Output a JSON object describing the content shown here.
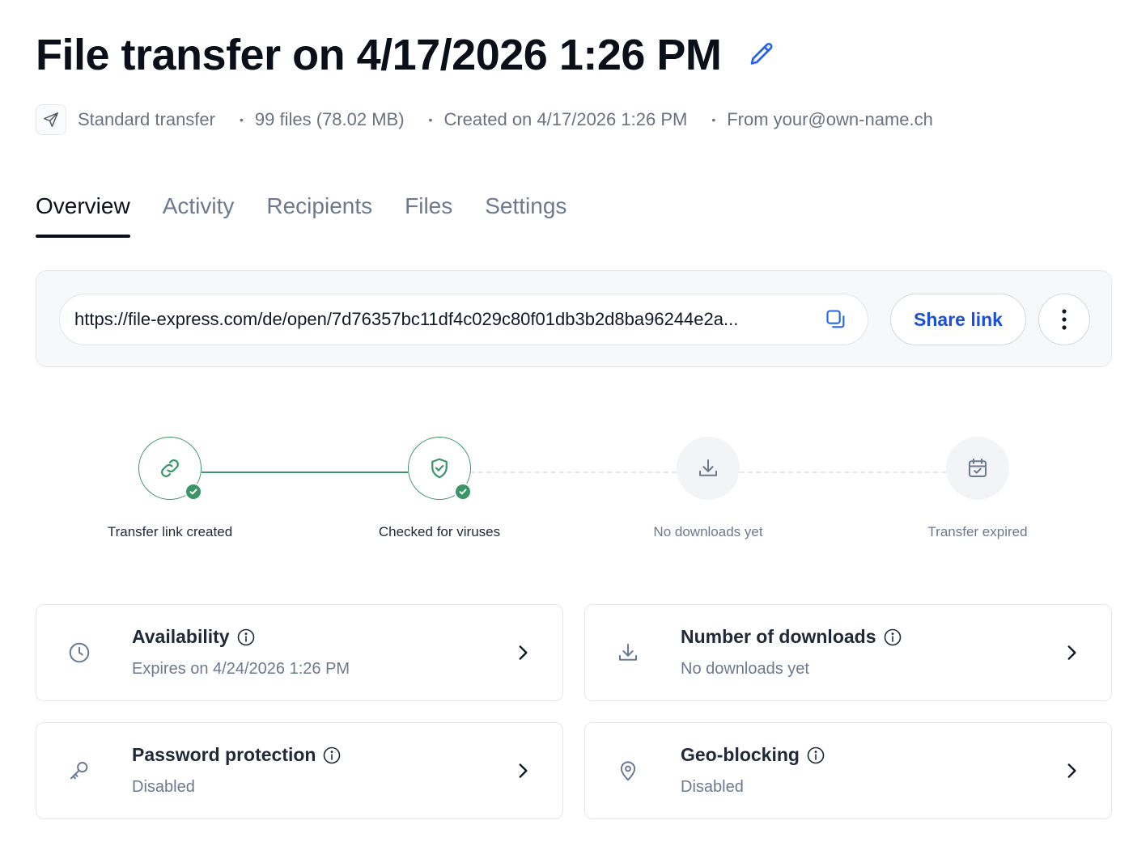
{
  "header": {
    "title": "File transfer on 4/17/2026 1:26 PM"
  },
  "meta": {
    "type_label": "Standard transfer",
    "files": "99 files (78.02 MB)",
    "created": "Created on 4/17/2026 1:26 PM",
    "from": "From your@own-name.ch",
    "separator": "•"
  },
  "tabs": [
    {
      "label": "Overview",
      "active": true
    },
    {
      "label": "Activity",
      "active": false
    },
    {
      "label": "Recipients",
      "active": false
    },
    {
      "label": "Files",
      "active": false
    },
    {
      "label": "Settings",
      "active": false
    }
  ],
  "link_panel": {
    "url": "https://file-express.com/de/open/7d76357bc11df4c029c80f01db3b2d8ba96244e2a...",
    "share_label": "Share link"
  },
  "progress": {
    "steps": [
      {
        "label": "Transfer link created",
        "status": "done",
        "icon": "link-icon"
      },
      {
        "label": "Checked for viruses",
        "status": "done",
        "icon": "shield-check-icon"
      },
      {
        "label": "No downloads yet",
        "status": "pending",
        "icon": "download-icon"
      },
      {
        "label": "Transfer expired",
        "status": "pending",
        "icon": "calendar-check-icon"
      }
    ]
  },
  "cards": {
    "availability": {
      "title": "Availability",
      "subtitle": "Expires on 4/24/2026 1:26 PM",
      "icon": "clock-icon"
    },
    "downloads": {
      "title": "Number of downloads",
      "subtitle": "No downloads yet",
      "icon": "download-icon"
    },
    "password": {
      "title": "Password protection",
      "subtitle": "Disabled",
      "icon": "key-icon"
    },
    "geo": {
      "title": "Geo-blocking",
      "subtitle": "Disabled",
      "icon": "map-pin-icon"
    }
  },
  "colors": {
    "accent_blue": "#1d4ed8",
    "success_green": "#3b9566",
    "muted_text": "#6b7a90",
    "title_text": "#0b0f19"
  }
}
